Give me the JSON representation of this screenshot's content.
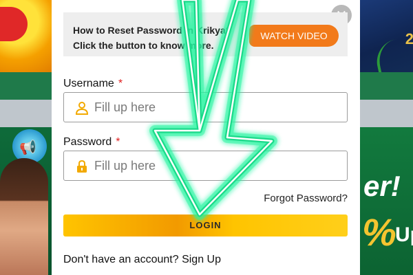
{
  "modal": {
    "help_text": "How to Reset Password in Krikya? Click the button to know more.",
    "watch_video_label": "WATCH VIDEO",
    "close_label": "✕",
    "username_label": "Username",
    "password_label": "Password",
    "required_mark": "*",
    "username_placeholder": "Fill up here",
    "password_placeholder": "Fill up here",
    "username_value": "",
    "password_value": "",
    "forgot_label": "Forgot Password?",
    "login_label": "LOGIN",
    "no_account_label": "Don't have an account?",
    "signup_label": "Sign Up"
  },
  "background": {
    "promo_er": "er!",
    "promo_pct": "%",
    "promo_up": "Up",
    "gold_text": "2"
  },
  "colors": {
    "accent_orange": "#f27a1a",
    "login_gold": "#ffc400",
    "icon_gold": "#f2a900",
    "neon_green": "#27f5a0",
    "required_red": "#e02020"
  },
  "icons": {
    "user": "user-icon",
    "lock": "lock-icon",
    "close": "close-icon",
    "arrow": "down-arrow-icon"
  }
}
